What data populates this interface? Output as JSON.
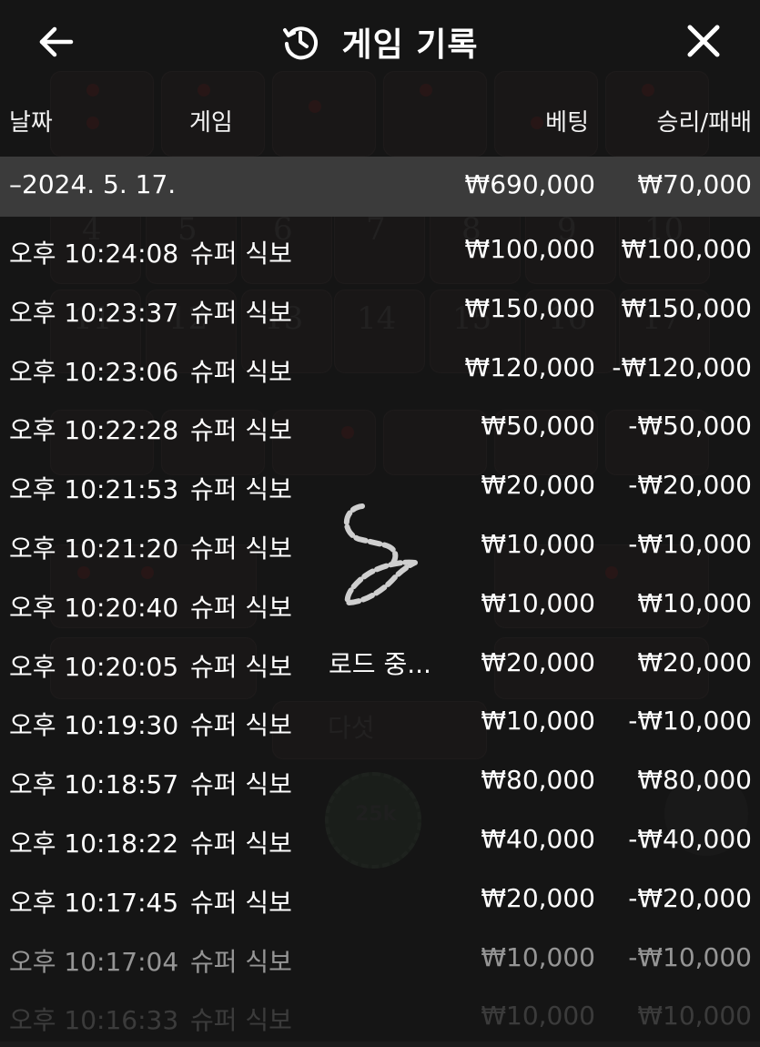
{
  "header": {
    "back_icon": "arrow-left-icon",
    "history_icon": "history-clock-icon",
    "title": "게임 기록",
    "close_icon": "close-icon"
  },
  "columns": {
    "date": "날짜",
    "game": "게임",
    "bet": "베팅",
    "result": "승리/패배"
  },
  "date_group": {
    "label": "–2024. 5. 17.",
    "bet_total": "₩690,000",
    "result_total": "₩70,000"
  },
  "records": [
    {
      "time": "오후 10:24:08",
      "game": "슈퍼 식보",
      "bet": "₩100,000",
      "result": "₩100,000"
    },
    {
      "time": "오후 10:23:37",
      "game": "슈퍼 식보",
      "bet": "₩150,000",
      "result": "₩150,000"
    },
    {
      "time": "오후 10:23:06",
      "game": "슈퍼 식보",
      "bet": "₩120,000",
      "result": "-₩120,000"
    },
    {
      "time": "오후 10:22:28",
      "game": "슈퍼 식보",
      "bet": "₩50,000",
      "result": "-₩50,000"
    },
    {
      "time": "오후 10:21:53",
      "game": "슈퍼 식보",
      "bet": "₩20,000",
      "result": "-₩20,000"
    },
    {
      "time": "오후 10:21:20",
      "game": "슈퍼 식보",
      "bet": "₩10,000",
      "result": "-₩10,000"
    },
    {
      "time": "오후 10:20:40",
      "game": "슈퍼 식보",
      "bet": "₩10,000",
      "result": "₩10,000"
    },
    {
      "time": "오후 10:20:05",
      "game": "슈퍼 식보",
      "bet": "₩20,000",
      "result": "₩20,000"
    },
    {
      "time": "오후 10:19:30",
      "game": "슈퍼 식보",
      "bet": "₩10,000",
      "result": "-₩10,000"
    },
    {
      "time": "오후 10:18:57",
      "game": "슈퍼 식보",
      "bet": "₩80,000",
      "result": "₩80,000"
    },
    {
      "time": "오후 10:18:22",
      "game": "슈퍼 식보",
      "bet": "₩40,000",
      "result": "-₩40,000"
    },
    {
      "time": "오후 10:17:45",
      "game": "슈퍼 식보",
      "bet": "₩20,000",
      "result": "-₩20,000"
    },
    {
      "time": "오후 10:17:04",
      "game": "슈퍼 식보",
      "bet": "₩10,000",
      "result": "-₩10,000"
    },
    {
      "time": "오후 10:16:33",
      "game": "슈퍼 식보",
      "bet": "₩10,000",
      "result": "₩10,000"
    }
  ],
  "loading": {
    "icon": "loading-spinner-icon",
    "text": "로드 중..."
  },
  "background": {
    "board_numbers": [
      "4",
      "5",
      "6",
      "7",
      "8",
      "9",
      "10",
      "11",
      "12",
      "13",
      "14",
      "15",
      "16",
      "17"
    ],
    "board_labels": [
      "다섯"
    ],
    "chip_label": "25k"
  },
  "colors": {
    "background": "#1b1b1b",
    "date_row": "#3b3b3b",
    "text": "#ffffff"
  }
}
